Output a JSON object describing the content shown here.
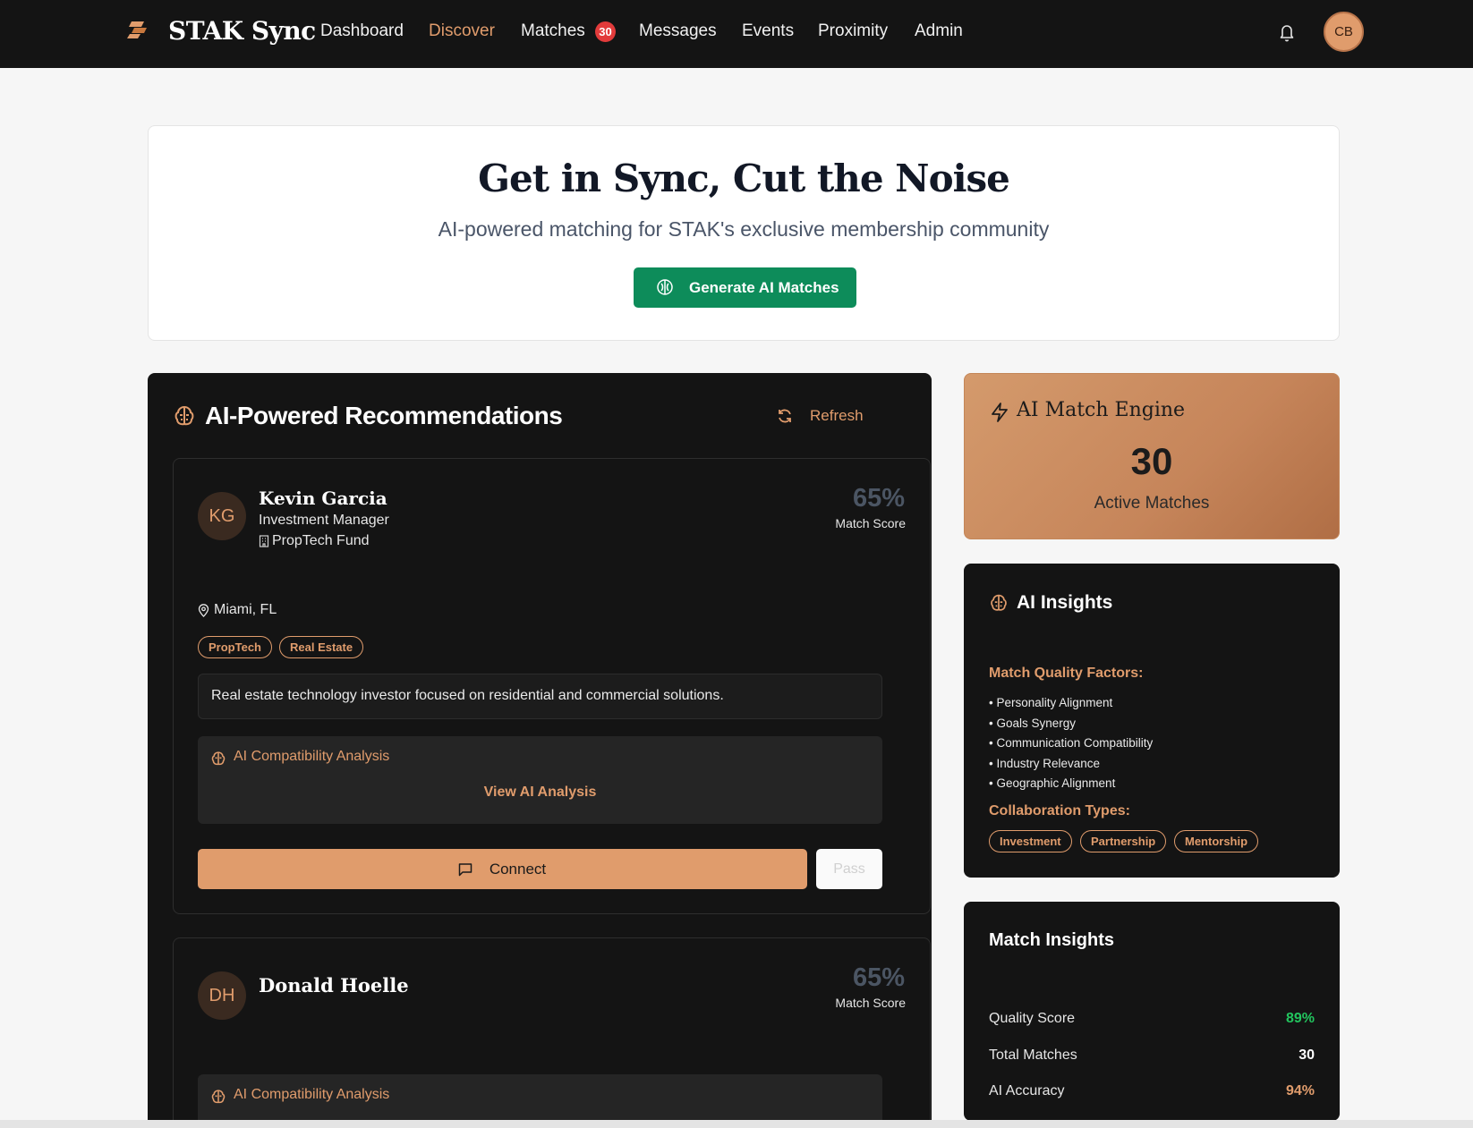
{
  "app": {
    "brand": "STAK Sync",
    "notifications_icon": "bell-icon",
    "user_initials": "CB",
    "accent_color": "#e09c6c",
    "primary_button_color": "#0d8c5a"
  },
  "nav": {
    "items": [
      {
        "label": "Dashboard"
      },
      {
        "label": "Discover",
        "active": true
      },
      {
        "label": "Matches",
        "badge": "30"
      },
      {
        "label": "Messages"
      },
      {
        "label": "Events"
      },
      {
        "label": "Proximity"
      },
      {
        "label": "Admin"
      }
    ]
  },
  "hero": {
    "title": "Get in Sync, Cut the Noise",
    "subtitle": "AI-powered matching for STAK's exclusive membership community",
    "button_label": "Generate AI Matches"
  },
  "recommendations": {
    "title": "AI-Powered Recommendations",
    "refresh_label": "Refresh",
    "cards": [
      {
        "initials": "KG",
        "name": "Kevin Garcia",
        "role": "Investment Manager",
        "company": "PropTech Fund",
        "score": "65%",
        "score_label": "Match Score",
        "location": "Miami, FL",
        "tags": [
          "PropTech",
          "Real Estate"
        ],
        "bio": "Real estate technology investor focused on residential and commercial solutions.",
        "ai_title": "AI Compatibility Analysis",
        "ai_link": "View AI Analysis",
        "connect_label": "Connect",
        "pass_label": "Pass"
      },
      {
        "initials": "DH",
        "name": "Donald Hoelle",
        "score": "65%",
        "score_label": "Match Score",
        "ai_title": "AI Compatibility Analysis"
      }
    ]
  },
  "engine": {
    "title": "AI Match Engine",
    "count": "30",
    "label": "Active Matches"
  },
  "ai_insights": {
    "title": "AI Insights",
    "factors_title": "Match Quality Factors:",
    "factors": [
      "Personality Alignment",
      "Goals Synergy",
      "Communication Compatibility",
      "Industry Relevance",
      "Geographic Alignment"
    ],
    "collab_title": "Collaboration Types:",
    "collab_types": [
      "Investment",
      "Partnership",
      "Mentorship"
    ]
  },
  "match_insights": {
    "title": "Match Insights",
    "rows": [
      {
        "label": "Quality Score",
        "value": "89%",
        "color": "#22c55e"
      },
      {
        "label": "Total Matches",
        "value": "30",
        "color": "#ffffff"
      },
      {
        "label": "AI Accuracy",
        "value": "94%",
        "color": "#e09c6c"
      }
    ]
  }
}
